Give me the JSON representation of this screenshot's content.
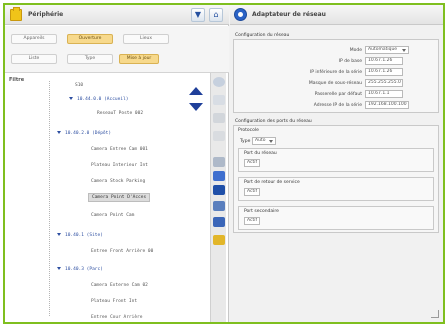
{
  "left_panel": {
    "title": "Périphérie",
    "toolbar": [
      {
        "label": "Appareils",
        "active": false
      },
      {
        "label": "Ouverture",
        "active": true
      },
      {
        "label": "Lieux",
        "active": false
      },
      {
        "label": "Liste",
        "active": false
      },
      {
        "label": "Type",
        "active": false
      },
      {
        "label": "Mise à jour",
        "active": true
      }
    ],
    "filter_label": "Filtre",
    "tree": [
      {
        "text": "S10",
        "kind": "leaf"
      },
      {
        "text": "10.44.0.0 (Accueil)",
        "kind": "node"
      },
      {
        "text": "ReseauT Poste 002",
        "kind": "leaf"
      },
      {
        "text": "10.40.2.0 (Dépôt)",
        "kind": "node"
      },
      {
        "text": "Camera Entree Cam 001",
        "kind": "leaf"
      },
      {
        "text": "Plateau Interieur Int",
        "kind": "leaf"
      },
      {
        "text": "Camera Stock Parking",
        "kind": "leaf"
      },
      {
        "text": "Camera Point D'Acces",
        "kind": "leaf"
      },
      {
        "text": "Camera Point Cam",
        "kind": "leaf"
      },
      {
        "text": "10.40.1 (Site)",
        "kind": "node"
      },
      {
        "text": "Entree Front Arrière 00",
        "kind": "leaf"
      },
      {
        "text": "10.40.3 (Parc)",
        "kind": "node"
      },
      {
        "text": "Camera Externe Cam 02",
        "kind": "leaf"
      },
      {
        "text": "Plateau Front Int",
        "kind": "leaf"
      },
      {
        "text": "Entree Cour Arrière",
        "kind": "leaf"
      }
    ]
  },
  "right_panel": {
    "title": "Adaptateur de réseau",
    "config_section_title": "Configuration du réseau",
    "fields": [
      {
        "label": "Mode",
        "value": "Automatique",
        "dropdown": true
      },
      {
        "label": "IP de base",
        "value": "10.67.1.26",
        "dropdown": false
      },
      {
        "label": "IP inférieure de la série",
        "value": "10.67.1.26",
        "dropdown": false
      },
      {
        "label": "Masque de sous-réseau",
        "value": "255.255.255.0",
        "dropdown": false
      },
      {
        "label": "Passerelle par défaut",
        "value": "10.67.1.1",
        "dropdown": false
      },
      {
        "label": "Adresse IP de la série",
        "value": "192.168.100.100",
        "dropdown": false
      }
    ],
    "ports_section_title": "Configuration des ports du réseau",
    "ports_subtitle": "Protocole",
    "port_type": {
      "label": "Type",
      "value": "Auto"
    },
    "groups": [
      {
        "title": "Port du réseau",
        "value": "Actif"
      },
      {
        "title": "Port de retour de service",
        "value": "Actif"
      },
      {
        "title": "Port secondaire",
        "value": "Actif"
      }
    ]
  }
}
